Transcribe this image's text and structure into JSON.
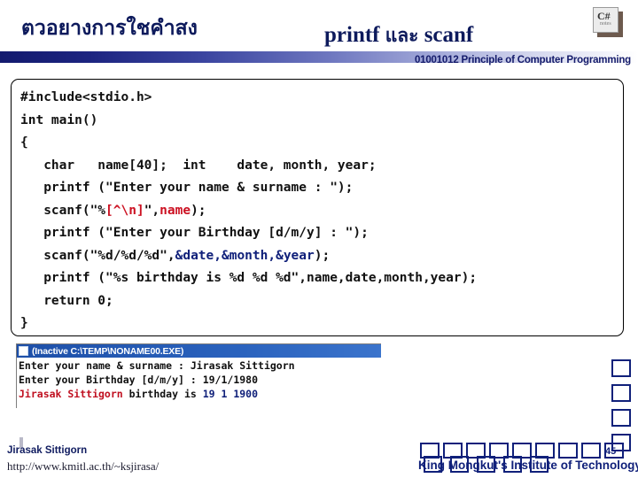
{
  "header": {
    "title_thai": "ตวอยางการใชคำสง",
    "title_en_prefix": "printf ",
    "title_en_thai": "และ",
    "title_en_suffix": " scanf",
    "course_line": "01001012 Principle of Computer Programming",
    "notebook_icon_text": "C#",
    "notebook_icon_sub": "notes",
    "band_color_start": "#131a6e",
    "band_color_end": "#ffffff",
    "title_color": "#0d1a5c"
  },
  "code": {
    "lines": [
      [
        {
          "t": "#include<stdio.h>",
          "c": "plain"
        }
      ],
      [
        {
          "t": "int main()",
          "c": "plain"
        }
      ],
      [
        {
          "t": "{",
          "c": "plain"
        }
      ],
      [
        {
          "t": "   char   name[40];  int    date, month, year;",
          "c": "plain"
        }
      ],
      [
        {
          "t": "   printf (\"Enter your name & surname : \");",
          "c": "plain"
        }
      ],
      [
        {
          "t": "   scanf(\"%",
          "c": "plain"
        },
        {
          "t": "[^\\n]",
          "c": "red"
        },
        {
          "t": "\",",
          "c": "plain"
        },
        {
          "t": "name",
          "c": "red"
        },
        {
          "t": ");",
          "c": "plain"
        }
      ],
      [
        {
          "t": "   printf (\"Enter your Birthday [d/m/y] : \");",
          "c": "plain"
        }
      ],
      [
        {
          "t": "   scanf(\"%d/%d/%d\",",
          "c": "plain"
        },
        {
          "t": "&date,&month,&year",
          "c": "navy"
        },
        {
          "t": ");",
          "c": "plain"
        }
      ],
      [
        {
          "t": "   printf (\"%s birthday is %d %d %d\",name,date,month,year);",
          "c": "plain"
        }
      ],
      [
        {
          "t": "   return 0;",
          "c": "plain"
        }
      ],
      [
        {
          "t": "}",
          "c": "plain"
        }
      ]
    ],
    "color_red": "#cc1122",
    "color_navy": "#10207a",
    "color_plain": "#111111"
  },
  "console": {
    "title": "(Inactive C:\\TEMP\\NONAME00.EXE)",
    "titlebar_color": "#1d4fa8",
    "lines": [
      [
        {
          "t": "Enter your name & surname : Jirasak Sittigorn",
          "c": "plain"
        }
      ],
      [
        {
          "t": "Enter your Birthday [d/m/y] : 19/1/1980",
          "c": "plain"
        }
      ],
      [
        {
          "t": "Jirasak Sittigorn",
          "c": "red"
        },
        {
          "t": " birthday is ",
          "c": "plain"
        },
        {
          "t": "19 1 1900",
          "c": "navy"
        }
      ]
    ],
    "color_red": "#c01020",
    "color_navy": "#10207a"
  },
  "footer": {
    "author": "Jirasak Sittigorn",
    "url": "http://www.kmitl.ac.th/~ksjirasa/",
    "institute": "King Mongkut's Institute of Technology",
    "page_number": "45",
    "tofu_column_count": 4,
    "tofu_row_count": 9,
    "tofu_row2_count": 5
  }
}
